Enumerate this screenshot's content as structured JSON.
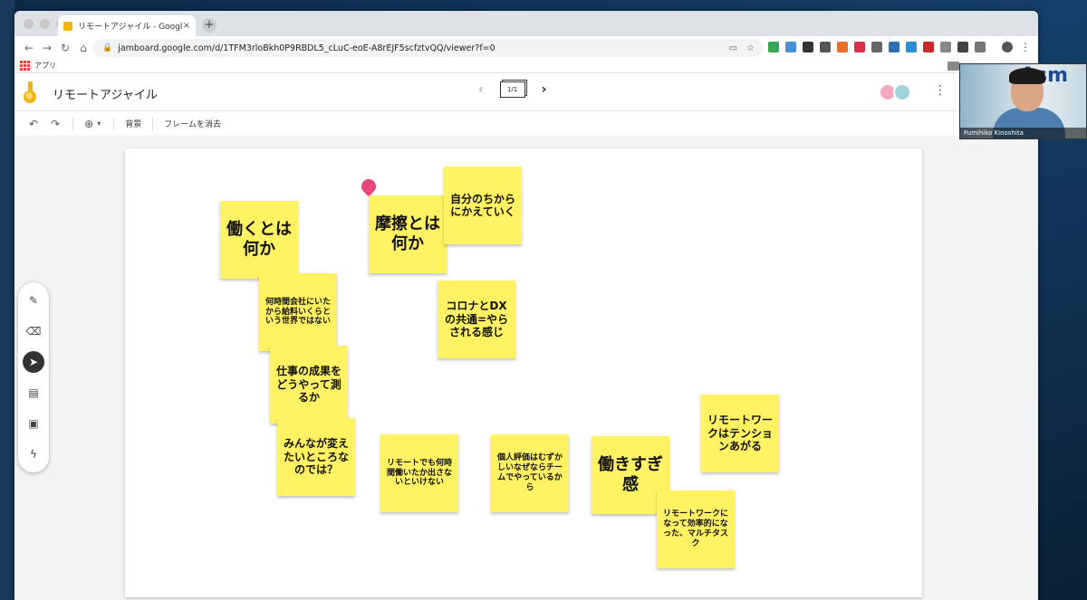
{
  "browser": {
    "tab_title": "リモートアジャイル - Google Jam",
    "tab_close": "×",
    "new_tab": "+",
    "url": "jamboard.google.com/d/1TFM3rloBkh0P9RBDL5_cLuC-eoE-A8rEJF5scfztvQQ/viewer?f=0",
    "bookmark_apps": "アプリ",
    "nav_back": "←",
    "nav_forward": "→",
    "nav_reload": "↻",
    "nav_home": "⌂",
    "menu": "⋮"
  },
  "app": {
    "title": "リモートアジャイル",
    "frame_indicator": "1/1",
    "prev": "‹",
    "next": "›",
    "more": "⋮"
  },
  "toolbar": {
    "undo": "↶",
    "redo": "↷",
    "zoom": "⊕",
    "zoom_caret": "▾",
    "background": "背景",
    "clear_frame": "フレームを消去"
  },
  "sidetools": {
    "pen": "✎",
    "eraser": "⌫",
    "select": "➤",
    "sticky": "▤",
    "image": "▣",
    "laser": "ϟ"
  },
  "notes": [
    {
      "id": "n1",
      "text": "働くとは何か"
    },
    {
      "id": "n2",
      "text": "摩擦とは何か"
    },
    {
      "id": "n3",
      "text": "自分のちからにかえていく"
    },
    {
      "id": "n4",
      "text": "何時間会社にいたから給料いくらという世界ではない"
    },
    {
      "id": "n5",
      "text": "コロナとDXの共通=やらされる感じ"
    },
    {
      "id": "n6",
      "text": "仕事の成果をどうやって測るか"
    },
    {
      "id": "n7",
      "text": "みんなが変えたいところなのでは？"
    },
    {
      "id": "n8",
      "text": "リモートでも何時間働いたか出さないといけない"
    },
    {
      "id": "n9",
      "text": "個人評価はむずかしいなぜならチームでやっているから"
    },
    {
      "id": "n10",
      "text": "働きすぎ感"
    },
    {
      "id": "n11",
      "text": "リモートワークはテンションあがる"
    },
    {
      "id": "n12",
      "text": "リモートワークになって効率的になった、マルチタスク"
    }
  ],
  "webcam": {
    "name": "Fumihiko Kinoshita",
    "sign_text": "Asm"
  },
  "colors": {
    "sticky": "#fff263",
    "accent_logo": "#f4b400",
    "pin": "#e8457a"
  }
}
